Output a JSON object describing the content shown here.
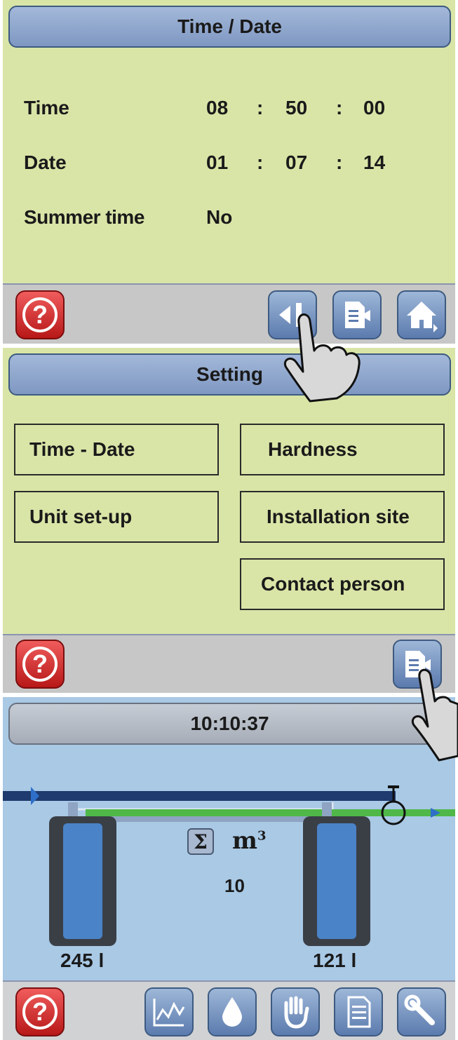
{
  "screen1": {
    "title": "Time / Date",
    "rows": [
      {
        "label": "Time",
        "v1": "08",
        "sep1": ":",
        "v2": "50",
        "sep2": ":",
        "v3": "00"
      },
      {
        "label": "Date",
        "v1": "01",
        "sep1": ":",
        "v2": "07",
        "sep2": ":",
        "v3": "14"
      },
      {
        "label": "Summer time",
        "v1": "No"
      }
    ],
    "footer_buttons": [
      "help-icon",
      "back-icon",
      "menu-return-icon",
      "home-icon"
    ]
  },
  "screen2": {
    "title": "Setting",
    "menu": {
      "time_date": "Time - Date",
      "hardness": "Hardness",
      "unit_setup": "Unit set-up",
      "installation_site": "Installation site",
      "contact_person": "Contact person"
    },
    "footer_buttons": [
      "help-icon",
      "menu-return-icon"
    ]
  },
  "screen3": {
    "clock": "10:10:37",
    "sum_unit": "m",
    "sum_exponent": "3",
    "sum_value": "10",
    "tank_left": "245 l",
    "tank_right": "121 l",
    "footer_buttons": [
      "help-icon",
      "chart-icon",
      "water-drop-icon",
      "hand-icon",
      "document-icon",
      "wrench-icon"
    ]
  },
  "colors": {
    "settings_bg": "#d9e5a7",
    "overview_bg": "#a9c9e5",
    "title_bar": "#8fa7cf",
    "help_red": "#d12a2a",
    "footer_grey": "#c7c7c7"
  }
}
